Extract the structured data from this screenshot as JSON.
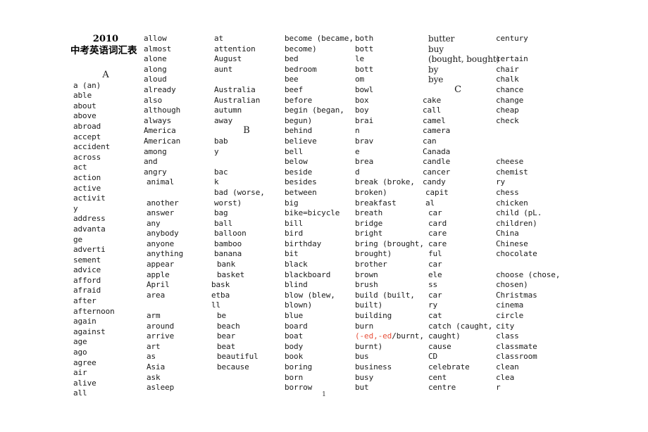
{
  "document": {
    "title_year": "2010",
    "title_cn": "中考英语词汇表",
    "page_number": "1"
  },
  "columns": [
    {
      "id": "column-1",
      "entries": [
        {
          "text": "A",
          "style": "letter"
        },
        {
          "text": "a (an)",
          "indent": 1
        },
        {
          "text": "able",
          "indent": 1
        },
        {
          "text": "about",
          "indent": 1
        },
        {
          "text": "above",
          "indent": 1
        },
        {
          "text": "abroad",
          "indent": 1
        },
        {
          "text": "accept",
          "indent": 1
        },
        {
          "text": "accident",
          "indent": 1
        },
        {
          "text": "across",
          "indent": 1
        },
        {
          "text": "act",
          "indent": 1
        },
        {
          "text": "action",
          "indent": 1
        },
        {
          "text": "active",
          "indent": 1
        },
        {
          "text": "activit",
          "indent": 1
        },
        {
          "text": "y",
          "indent": 1
        },
        {
          "text": "address",
          "indent": 1
        },
        {
          "text": "advanta",
          "indent": 1
        },
        {
          "text": "ge",
          "indent": 1
        },
        {
          "text": "adverti",
          "indent": 1
        },
        {
          "text": "sement",
          "indent": 1
        },
        {
          "text": "advice",
          "indent": 1
        },
        {
          "text": "afford",
          "indent": 1
        },
        {
          "text": "afraid",
          "indent": 1
        },
        {
          "text": "after",
          "indent": 1
        },
        {
          "text": "afternoon",
          "indent": 1
        },
        {
          "text": "again",
          "indent": 1
        },
        {
          "text": "against",
          "indent": 1
        },
        {
          "text": "age",
          "indent": 1
        },
        {
          "text": "ago",
          "indent": 1
        },
        {
          "text": "agree",
          "indent": 1
        },
        {
          "text": "air",
          "indent": 1
        },
        {
          "text": "alive",
          "indent": 1
        },
        {
          "text": "all",
          "indent": 1
        }
      ]
    },
    {
      "id": "column-2",
      "entries": [
        {
          "text": "allow",
          "indent": 1
        },
        {
          "text": "almost",
          "indent": 1
        },
        {
          "text": "alone",
          "indent": 1
        },
        {
          "text": "along",
          "indent": 1
        },
        {
          "text": "aloud",
          "indent": 1
        },
        {
          "text": "already",
          "indent": 1
        },
        {
          "text": "also",
          "indent": 1
        },
        {
          "text": "although",
          "indent": 1
        },
        {
          "text": "always",
          "indent": 1
        },
        {
          "text": "America",
          "indent": 1
        },
        {
          "text": "American",
          "indent": 1
        },
        {
          "text": "among",
          "indent": 1
        },
        {
          "text": "and",
          "indent": 1
        },
        {
          "text": "angry",
          "indent": 1
        },
        {
          "text": "animal",
          "indent": 2
        },
        {
          "text": "",
          "style": "blank"
        },
        {
          "text": "another",
          "indent": 2
        },
        {
          "text": "answer",
          "indent": 2
        },
        {
          "text": "any",
          "indent": 2
        },
        {
          "text": "anybody",
          "indent": 2
        },
        {
          "text": "anyone",
          "indent": 2
        },
        {
          "text": "anything",
          "indent": 2
        },
        {
          "text": "appear",
          "indent": 2
        },
        {
          "text": "apple",
          "indent": 2
        },
        {
          "text": "April",
          "indent": 2
        },
        {
          "text": "area",
          "indent": 2
        },
        {
          "text": "",
          "style": "blank"
        },
        {
          "text": "arm",
          "indent": 2
        },
        {
          "text": "around",
          "indent": 2
        },
        {
          "text": "arrive",
          "indent": 2
        },
        {
          "text": "art",
          "indent": 2
        },
        {
          "text": "as",
          "indent": 2
        },
        {
          "text": "Asia",
          "indent": 2
        },
        {
          "text": "ask",
          "indent": 2
        },
        {
          "text": "asleep",
          "indent": 2
        }
      ]
    },
    {
      "id": "column-3",
      "entries": [
        {
          "text": "at",
          "indent": 1
        },
        {
          "text": "attention",
          "indent": 1
        },
        {
          "text": "August",
          "indent": 1
        },
        {
          "text": "aunt",
          "indent": 1
        },
        {
          "text": "",
          "style": "blank"
        },
        {
          "text": "Australia",
          "indent": 1
        },
        {
          "text": "Australian",
          "indent": 1
        },
        {
          "text": "autumn",
          "indent": 1
        },
        {
          "text": "away",
          "indent": 1
        },
        {
          "text": "B",
          "style": "letter"
        },
        {
          "text": "bab",
          "indent": 1
        },
        {
          "text": "y",
          "indent": 1
        },
        {
          "text": "",
          "style": "blank"
        },
        {
          "text": "bac",
          "indent": 1
        },
        {
          "text": "k",
          "indent": 1
        },
        {
          "text": "bad (worse,",
          "indent": 1
        },
        {
          "text": "worst)",
          "indent": 1
        },
        {
          "text": "bag",
          "indent": 1
        },
        {
          "text": "ball",
          "indent": 1
        },
        {
          "text": "balloon",
          "indent": 1
        },
        {
          "text": "bamboo",
          "indent": 1
        },
        {
          "text": "banana",
          "indent": 1
        },
        {
          "text": "bank",
          "indent": 2
        },
        {
          "text": "basket",
          "indent": 2
        },
        {
          "text": "bask",
          "indent": 0
        },
        {
          "text": "etba",
          "indent": 0
        },
        {
          "text": "ll",
          "indent": 0
        },
        {
          "text": "be",
          "indent": 2
        },
        {
          "text": "beach",
          "indent": 2
        },
        {
          "text": "bear",
          "indent": 2
        },
        {
          "text": "beat",
          "indent": 2
        },
        {
          "text": "beautiful",
          "indent": 2
        },
        {
          "text": "because",
          "indent": 2
        }
      ]
    },
    {
      "id": "column-4",
      "entries": [
        {
          "text": "become (became,",
          "indent": 1
        },
        {
          "text": "become)",
          "indent": 1
        },
        {
          "text": "bed",
          "indent": 1
        },
        {
          "text": "bedroom",
          "indent": 1
        },
        {
          "text": "bee",
          "indent": 1
        },
        {
          "text": "beef",
          "indent": 1
        },
        {
          "text": "before",
          "indent": 1
        },
        {
          "text": "begin (began,",
          "indent": 1
        },
        {
          "text": "begun)",
          "indent": 1
        },
        {
          "text": "behind",
          "indent": 1
        },
        {
          "text": "believe",
          "indent": 1
        },
        {
          "text": "bell",
          "indent": 1
        },
        {
          "text": "below",
          "indent": 1
        },
        {
          "text": "beside",
          "indent": 1
        },
        {
          "text": "besides",
          "indent": 1
        },
        {
          "text": "between",
          "indent": 1
        },
        {
          "text": "big",
          "indent": 1
        },
        {
          "text": "bike=bicycle",
          "indent": 1
        },
        {
          "text": "bill",
          "indent": 1
        },
        {
          "text": "bird",
          "indent": 1
        },
        {
          "text": "birthday",
          "indent": 1
        },
        {
          "text": "bit",
          "indent": 1
        },
        {
          "text": "black",
          "indent": 1
        },
        {
          "text": "blackboard",
          "indent": 1
        },
        {
          "text": "blind",
          "indent": 1
        },
        {
          "text": "blow (blew,",
          "indent": 1
        },
        {
          "text": "blown)",
          "indent": 1
        },
        {
          "text": "blue",
          "indent": 1
        },
        {
          "text": "board",
          "indent": 1
        },
        {
          "text": "boat",
          "indent": 1
        },
        {
          "text": "body",
          "indent": 1
        },
        {
          "text": "book",
          "indent": 1
        },
        {
          "text": "boring",
          "indent": 1
        },
        {
          "text": "born",
          "indent": 1
        },
        {
          "text": "borrow",
          "indent": 1
        }
      ]
    },
    {
      "id": "column-5",
      "entries": [
        {
          "text": "both",
          "indent": 1
        },
        {
          "text": "bott",
          "indent": 1
        },
        {
          "text": "le",
          "indent": 1
        },
        {
          "text": "bott",
          "indent": 1
        },
        {
          "text": "om",
          "indent": 1
        },
        {
          "text": "bowl",
          "indent": 1
        },
        {
          "text": "box",
          "indent": 1
        },
        {
          "text": "boy",
          "indent": 1
        },
        {
          "text": "brai",
          "indent": 1
        },
        {
          "text": "n",
          "indent": 1
        },
        {
          "text": "brav",
          "indent": 1
        },
        {
          "text": "e",
          "indent": 1
        },
        {
          "text": "brea",
          "indent": 1
        },
        {
          "text": "d",
          "indent": 1
        },
        {
          "text": "break (broke,",
          "indent": 1
        },
        {
          "text": "broken)",
          "indent": 1
        },
        {
          "text": "breakfast",
          "indent": 1
        },
        {
          "text": "breath",
          "indent": 1
        },
        {
          "text": "bridge",
          "indent": 1
        },
        {
          "text": "bright",
          "indent": 1
        },
        {
          "text": "bring (brought,",
          "indent": 1
        },
        {
          "text": "brought)",
          "indent": 1
        },
        {
          "text": "brother",
          "indent": 1
        },
        {
          "text": "brown",
          "indent": 1
        },
        {
          "text": "brush",
          "indent": 1
        },
        {
          "text": "build (built,",
          "indent": 1
        },
        {
          "text": "built)",
          "indent": 1
        },
        {
          "text": "building",
          "indent": 1
        },
        {
          "text": "burn",
          "indent": 1
        },
        {
          "text": "(-ed,-ed/burnt,",
          "indent": 1,
          "red_prefix": "(-ed,-ed",
          "black_suffix": "/burnt,"
        },
        {
          "text": "burnt)",
          "indent": 1
        },
        {
          "text": "bus",
          "indent": 1
        },
        {
          "text": "business",
          "indent": 1
        },
        {
          "text": "busy",
          "indent": 1
        },
        {
          "text": "but",
          "indent": 1
        }
      ]
    },
    {
      "id": "column-6",
      "entries": [
        {
          "text": "butter",
          "indent": 2,
          "style": "serif"
        },
        {
          "text": "buy",
          "indent": 2,
          "style": "serif"
        },
        {
          "text": "(bought, bought)",
          "indent": 2,
          "style": "serif"
        },
        {
          "text": "by",
          "indent": 2,
          "style": "serif"
        },
        {
          "text": "bye",
          "indent": 2,
          "style": "serif"
        },
        {
          "text": "C",
          "style": "letter"
        },
        {
          "text": "cake",
          "indent": 0
        },
        {
          "text": "call",
          "indent": 0
        },
        {
          "text": "camel",
          "indent": 0
        },
        {
          "text": "camera",
          "indent": 0
        },
        {
          "text": "can",
          "indent": 0
        },
        {
          "text": "Canada",
          "indent": 0
        },
        {
          "text": "candle",
          "indent": 0
        },
        {
          "text": "cancer",
          "indent": 0
        },
        {
          "text": "candy",
          "indent": 0
        },
        {
          "text": "capit",
          "indent": 1
        },
        {
          "text": "al",
          "indent": 1
        },
        {
          "text": "car",
          "indent": 2
        },
        {
          "text": "card",
          "indent": 2
        },
        {
          "text": "care",
          "indent": 2
        },
        {
          "text": "care",
          "indent": 2
        },
        {
          "text": "ful",
          "indent": 2
        },
        {
          "text": "car",
          "indent": 2
        },
        {
          "text": "ele",
          "indent": 2
        },
        {
          "text": "ss",
          "indent": 2
        },
        {
          "text": "car",
          "indent": 2
        },
        {
          "text": "ry",
          "indent": 2
        },
        {
          "text": "cat",
          "indent": 2
        },
        {
          "text": "catch (caught,",
          "indent": 2
        },
        {
          "text": "caught)",
          "indent": 2
        },
        {
          "text": "cause",
          "indent": 2
        },
        {
          "text": "CD",
          "indent": 2
        },
        {
          "text": "celebrate",
          "indent": 2
        },
        {
          "text": "cent",
          "indent": 2
        },
        {
          "text": "centre",
          "indent": 2
        }
      ]
    },
    {
      "id": "column-7",
      "entries": [
        {
          "text": "century",
          "indent": 1
        },
        {
          "text": "",
          "style": "blank"
        },
        {
          "text": "certain",
          "indent": 1
        },
        {
          "text": "chair",
          "indent": 1
        },
        {
          "text": "chalk",
          "indent": 1
        },
        {
          "text": "chance",
          "indent": 1
        },
        {
          "text": "change",
          "indent": 1
        },
        {
          "text": "cheap",
          "indent": 1
        },
        {
          "text": "check",
          "indent": 1
        },
        {
          "text": "",
          "style": "blank"
        },
        {
          "text": "",
          "style": "blank"
        },
        {
          "text": "",
          "style": "blank"
        },
        {
          "text": "cheese",
          "indent": 1
        },
        {
          "text": "chemist",
          "indent": 1
        },
        {
          "text": "ry",
          "indent": 1
        },
        {
          "text": "chess",
          "indent": 1
        },
        {
          "text": "chicken",
          "indent": 1
        },
        {
          "text": "child (pL.",
          "indent": 1
        },
        {
          "text": "children)",
          "indent": 1
        },
        {
          "text": "China",
          "indent": 1
        },
        {
          "text": "Chinese",
          "indent": 1
        },
        {
          "text": "chocolate",
          "indent": 1
        },
        {
          "text": "",
          "style": "blank"
        },
        {
          "text": "choose (chose,",
          "indent": 1
        },
        {
          "text": "chosen)",
          "indent": 1
        },
        {
          "text": "Christmas",
          "indent": 1
        },
        {
          "text": "cinema",
          "indent": 1
        },
        {
          "text": "circle",
          "indent": 1
        },
        {
          "text": "city",
          "indent": 1
        },
        {
          "text": "class",
          "indent": 1
        },
        {
          "text": "classmate",
          "indent": 1
        },
        {
          "text": "classroom",
          "indent": 1
        },
        {
          "text": "clean",
          "indent": 1
        },
        {
          "text": "clea",
          "indent": 1
        },
        {
          "text": "r",
          "indent": 1
        }
      ]
    }
  ]
}
